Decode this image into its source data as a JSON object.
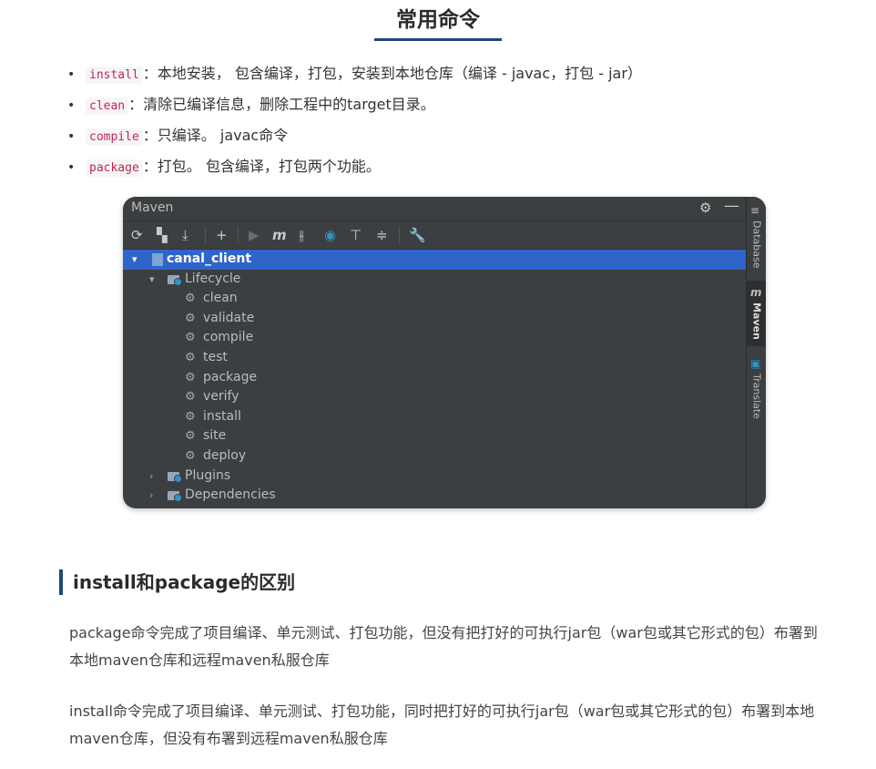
{
  "heading": "常用命令",
  "commands": [
    {
      "code": "install",
      "desc": "：本地安装， 包含编译，打包，安装到本地仓库（编译 - javac，打包 - jar）"
    },
    {
      "code": "clean",
      "desc": "：清除已编译信息，删除工程中的target目录。"
    },
    {
      "code": "compile",
      "desc": "：只编译。 javac命令"
    },
    {
      "code": "package",
      "desc": "：打包。 包含编译，打包两个功能。"
    }
  ],
  "bullet": "•",
  "maven": {
    "title": "Maven",
    "title_icons": [
      "gear-icon",
      "minimize-icon"
    ],
    "toolbar_icons": [
      "reload-icon",
      "add-folder-icon",
      "download-icon",
      "plus-icon",
      "run-icon",
      "maven-m-icon",
      "toggle-offline-icon",
      "skip-tests-icon",
      "show-dependencies-icon",
      "collapse-all-icon",
      "settings-wrench-icon"
    ],
    "toolbar_glyphs": {
      "m": "m"
    },
    "project": "canal_client",
    "lifecycle_label": "Lifecycle",
    "lifecycle": [
      "clean",
      "validate",
      "compile",
      "test",
      "package",
      "verify",
      "install",
      "site",
      "deploy"
    ],
    "plugins_label": "Plugins",
    "dependencies_label": "Dependencies",
    "side_tabs": [
      "Database",
      "Maven",
      "Translate"
    ],
    "side_m": "m"
  },
  "section2": {
    "heading": "install和package的区别",
    "p1": "package命令完成了项目编译、单元测试、打包功能，但没有把打好的可执行jar包（war包或其它形式的包）布署到本地maven仓库和远程maven私服仓库",
    "p2": "install命令完成了项目编译、单元测试、打包功能，同时把打好的可执行jar包（war包或其它形式的包）布署到本地maven仓库，但没有布署到远程maven私服仓库"
  }
}
